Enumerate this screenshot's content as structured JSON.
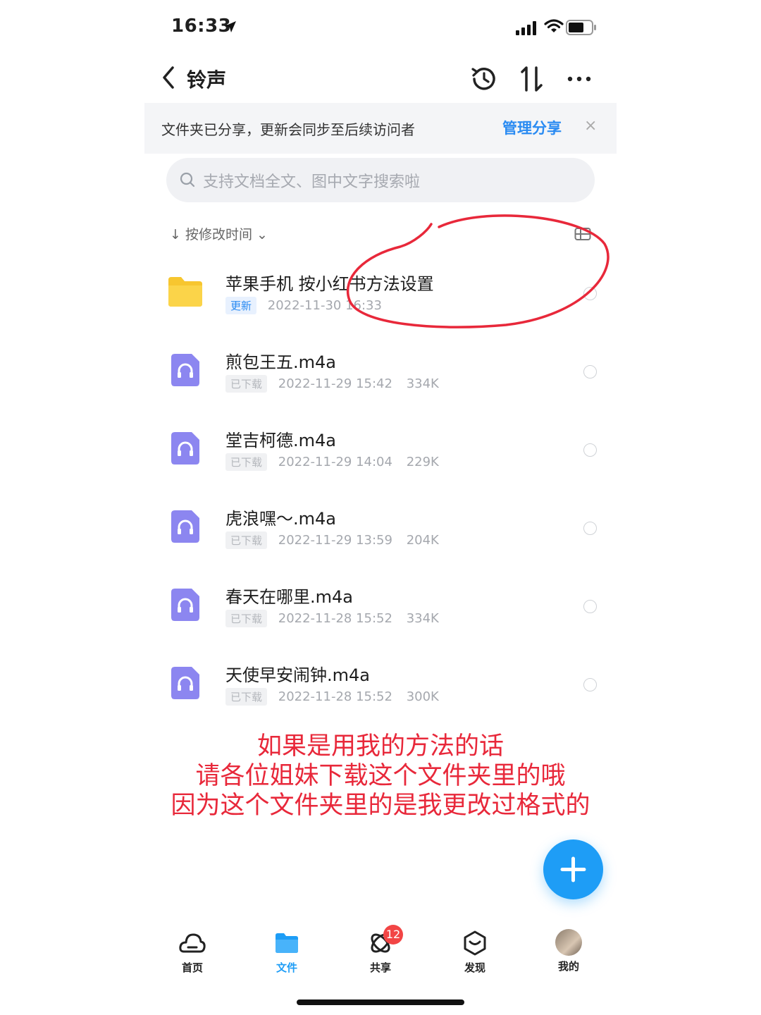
{
  "status_bar": {
    "time": "16:33"
  },
  "nav": {
    "title": "铃声"
  },
  "banner": {
    "text": "文件夹已分享，更新会同步至后续访问者",
    "link": "管理分享",
    "close": "×"
  },
  "search": {
    "placeholder": "支持文档全文、图中文字搜索啦"
  },
  "sort": {
    "label": "↓ 按修改时间 ⌄"
  },
  "files": [
    {
      "name": "苹果手机 按小红书方法设置",
      "tag": "更新",
      "date": "2022-11-30 16:33",
      "size": "",
      "kind": "folder"
    },
    {
      "name": "煎包王五.m4a",
      "tag": "已下载",
      "date": "2022-11-29 15:42",
      "size": "334K",
      "kind": "audio"
    },
    {
      "name": "堂吉柯德.m4a",
      "tag": "已下载",
      "date": "2022-11-29 14:04",
      "size": "229K",
      "kind": "audio"
    },
    {
      "name": "虎浪嘿～.m4a",
      "tag": "已下载",
      "date": "2022-11-29 13:59",
      "size": "204K",
      "kind": "audio"
    },
    {
      "name": "春天在哪里.m4a",
      "tag": "已下载",
      "date": "2022-11-28 15:52",
      "size": "334K",
      "kind": "audio"
    },
    {
      "name": "天使早安闹钟.m4a",
      "tag": "已下载",
      "date": "2022-11-28 15:52",
      "size": "300K",
      "kind": "audio"
    }
  ],
  "note": {
    "line1": "如果是用我的方法的话",
    "line2": "请各位姐妹下载这个文件夹里的哦",
    "line3": "因为这个文件夹里的是我更改过格式的"
  },
  "tabs": [
    {
      "label": "首页"
    },
    {
      "label": "文件"
    },
    {
      "label": "共享",
      "badge": "12"
    },
    {
      "label": "发现"
    },
    {
      "label": "我的"
    }
  ],
  "colors": {
    "accent": "#1e9df6",
    "annotation": "#e8283a",
    "badge": "#f24545",
    "folder": "#f7c62f",
    "audio": "#8c86f0"
  }
}
